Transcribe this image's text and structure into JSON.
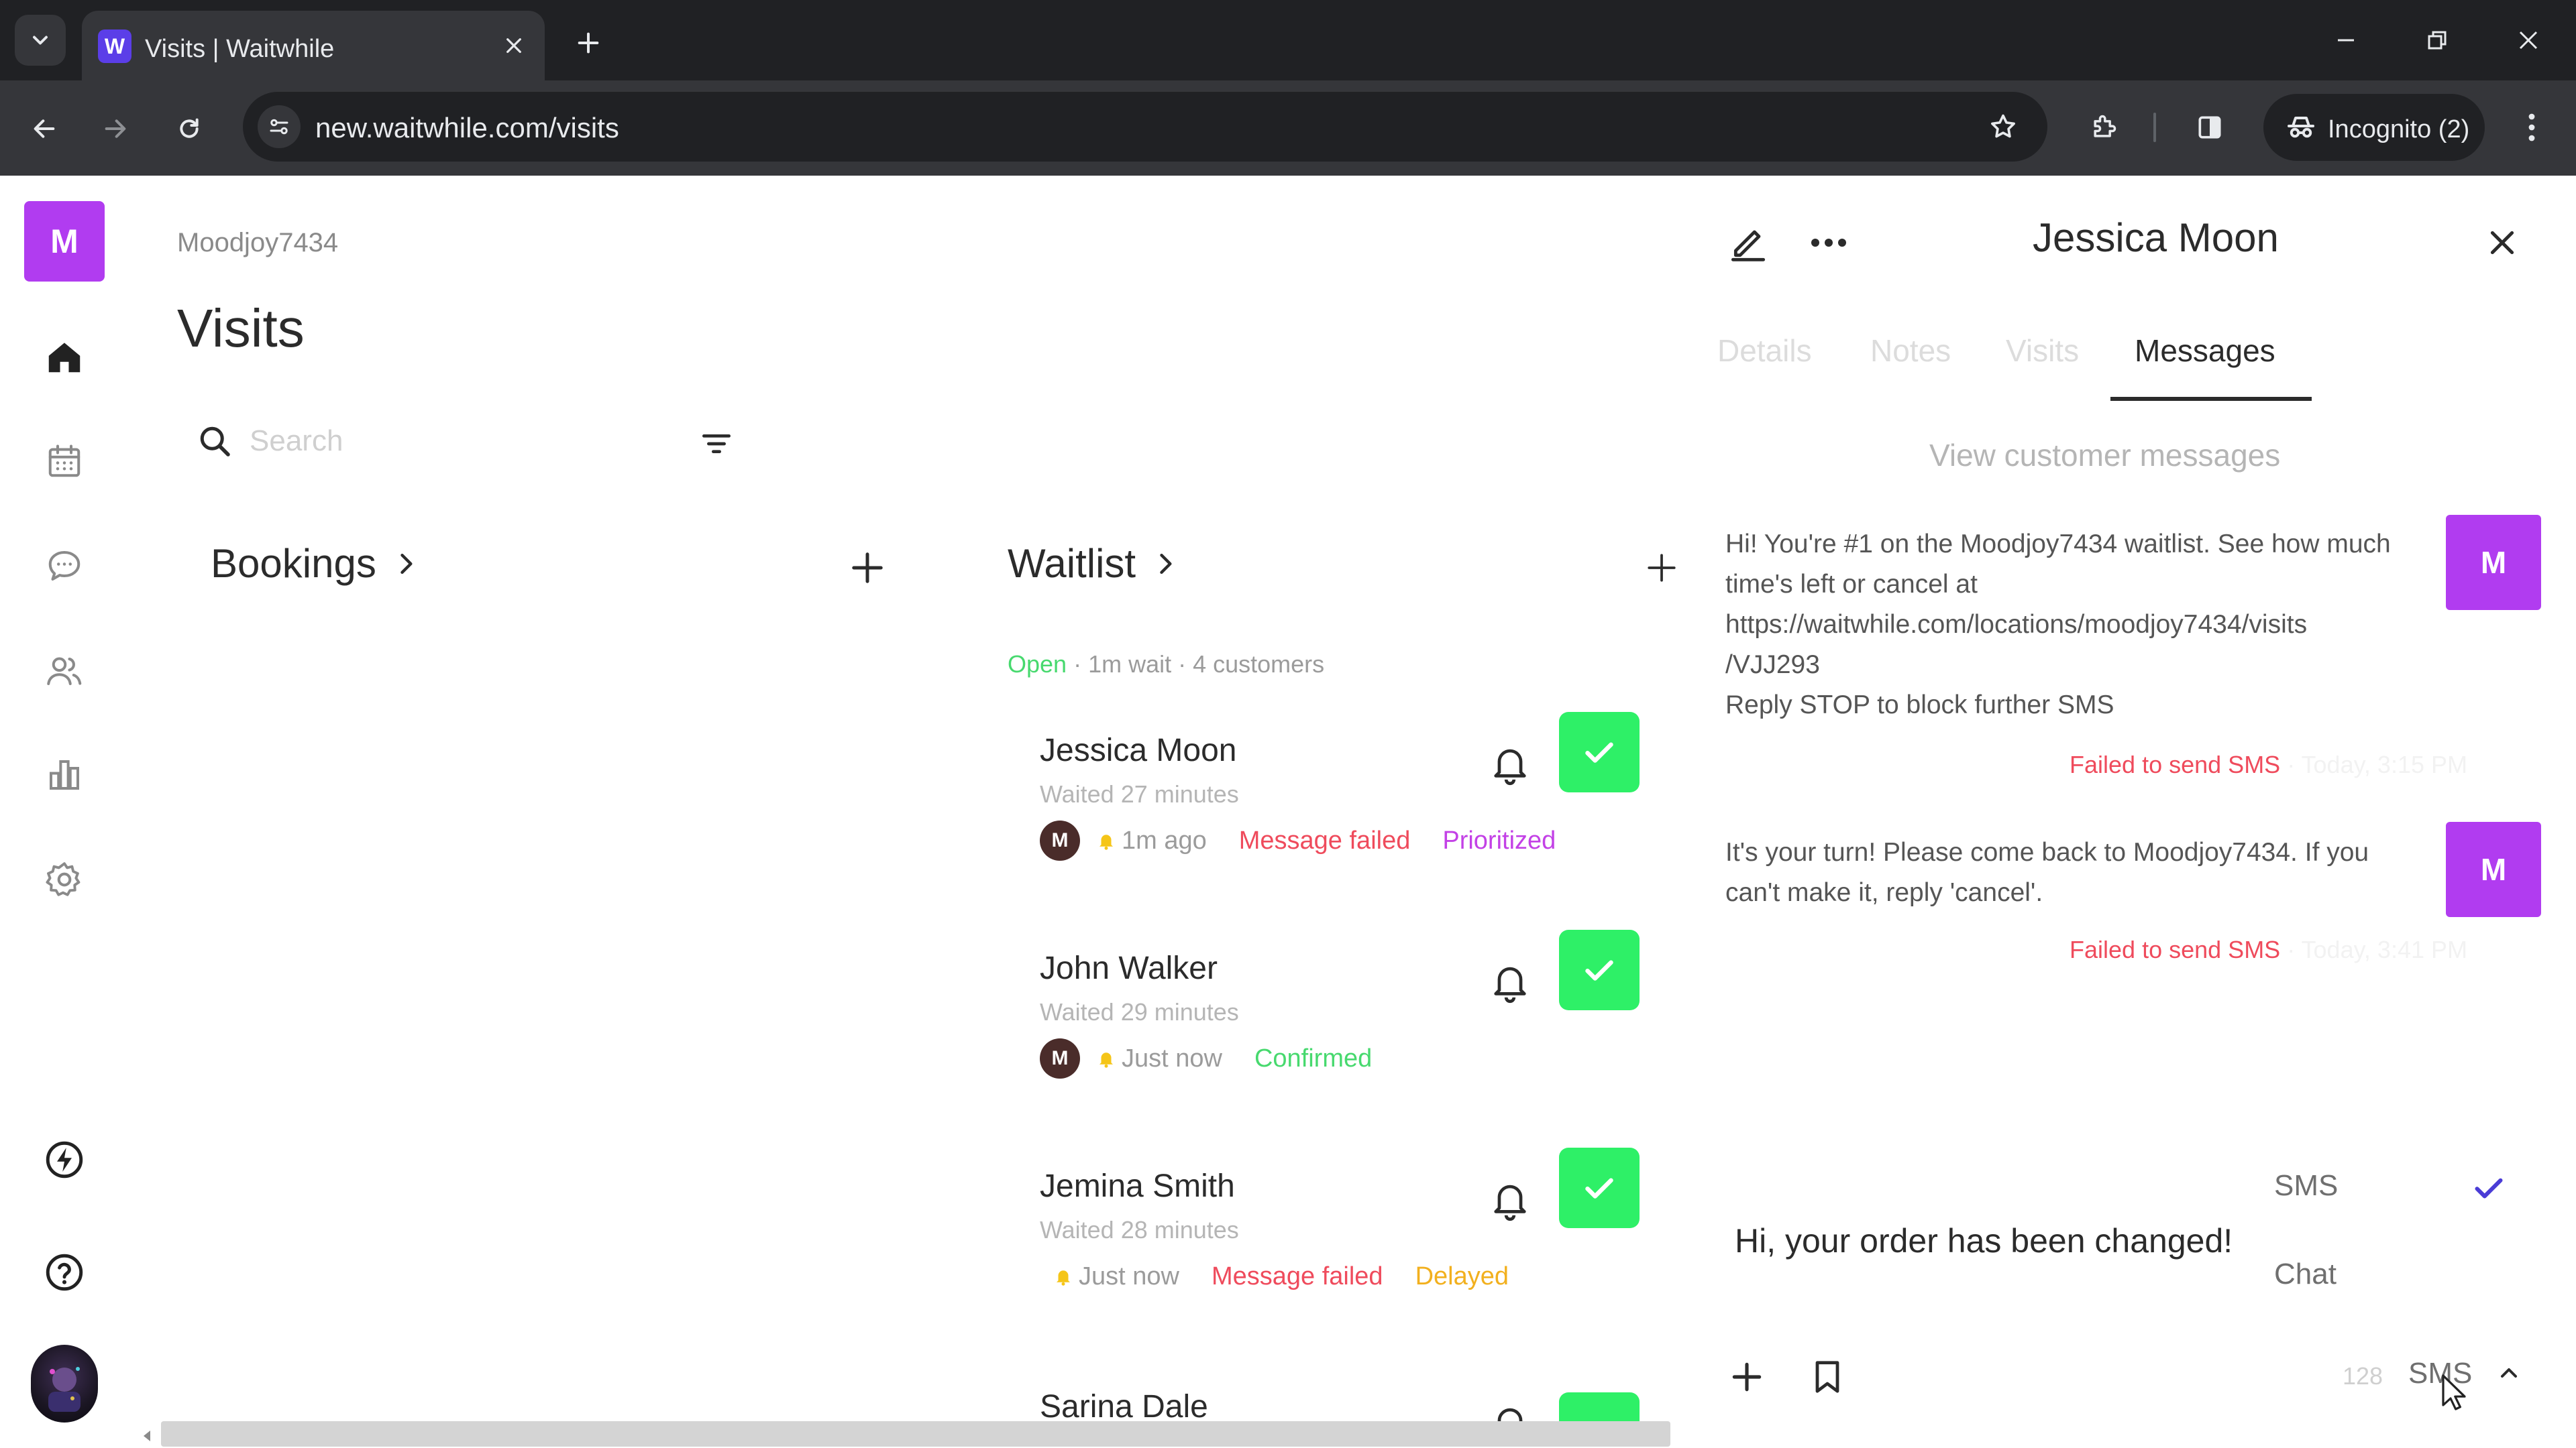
{
  "browser": {
    "tab_title": "Visits | Waitwhile",
    "tab_favicon_letter": "W",
    "url": "new.waitwhile.com/visits",
    "profile_label": "Incognito (2)"
  },
  "sidebar": {
    "brand_letter": "M",
    "items": [
      {
        "icon": "home-icon",
        "active": true
      },
      {
        "icon": "calendar-icon"
      },
      {
        "icon": "chat-icon"
      },
      {
        "icon": "people-icon"
      },
      {
        "icon": "analytics-icon"
      },
      {
        "icon": "gear-icon"
      },
      {
        "icon": "bolt-icon"
      },
      {
        "icon": "help-icon"
      }
    ]
  },
  "main": {
    "account_name": "Moodjoy7434",
    "title": "Visits",
    "search_placeholder": "Search",
    "bookings_label": "Bookings",
    "waitlist_label": "Waitlist",
    "waitlist_status": {
      "open": "Open",
      "rest": " · 1m wait · 4 customers"
    },
    "customers": [
      {
        "name": "Jessica Moon",
        "waited": "Waited 27 minutes",
        "avatar": "M",
        "time": "1m ago",
        "status1": "Message failed",
        "status2": "Prioritized"
      },
      {
        "name": "John Walker",
        "waited": "Waited 29 minutes",
        "avatar": "M",
        "time": "Just now",
        "status1": "Confirmed"
      },
      {
        "name": "Jemina Smith",
        "waited": "Waited 28 minutes",
        "time": "Just now",
        "status1": "Message failed",
        "status2": "Delayed"
      },
      {
        "name": "Sarina Dale"
      }
    ]
  },
  "panel": {
    "customer_name": "Jessica Moon",
    "tabs": [
      "Details",
      "Notes",
      "Visits",
      "Messages"
    ],
    "active_tab": "Messages",
    "view_link": "View customer messages",
    "messages": [
      {
        "lines": [
          "Hi! You're #1 on the Moodjoy7434 waitlist. See how much time's left or cancel at",
          "https://waitwhile.com/locations/moodjoy7434/visits",
          "/VJJ293",
          "Reply STOP to block further SMS"
        ],
        "status": "Failed to send SMS",
        "time": " · Today, 3:15 PM",
        "avatar": "M"
      },
      {
        "lines": [
          "It's your turn! Please come back to Moodjoy7434. If you can't make it, reply 'cancel'."
        ],
        "status": "Failed to send SMS",
        "time": " · Today, 3:41 PM",
        "avatar": "M"
      }
    ],
    "channel_options": [
      "SMS",
      "Chat"
    ],
    "selected_channel": "SMS",
    "compose_text": "Hi, your order has been changed!",
    "char_count": "128",
    "channel_selector_label": "SMS"
  },
  "colors": {
    "brand": "#b13cf0",
    "success": "#2ef067",
    "failed": "#ef4b5c",
    "prioritized": "#c341e6",
    "confirmed": "#47d96e",
    "delayed": "#f2b01e"
  }
}
